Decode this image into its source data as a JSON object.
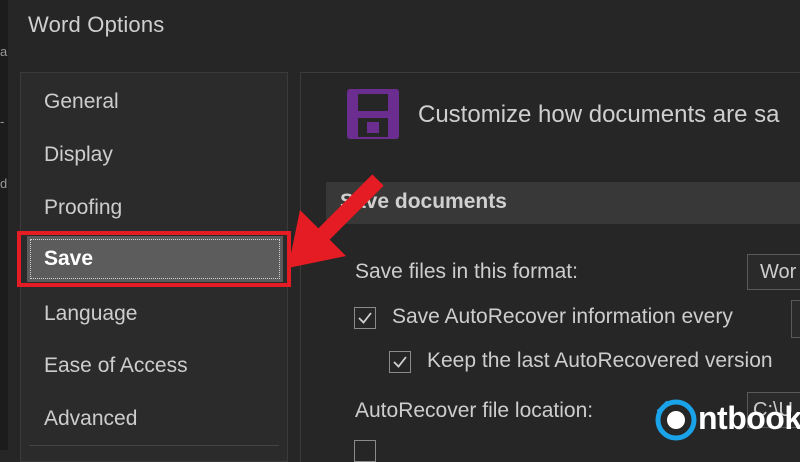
{
  "window": {
    "title": "Word Options"
  },
  "nav": {
    "items": [
      {
        "label": "General"
      },
      {
        "label": "Display"
      },
      {
        "label": "Proofing"
      },
      {
        "label": "Save",
        "selected": true
      },
      {
        "label": "Language"
      },
      {
        "label": "Ease of Access"
      },
      {
        "label": "Advanced"
      }
    ]
  },
  "content": {
    "heading": "Customize how documents are sa",
    "section_title": "Save documents",
    "format_label": "Save files in this format:",
    "format_value": "Wor",
    "autorecover_label": "Save AutoRecover information every",
    "autorecover_checked": true,
    "keep_last_label": "Keep the last AutoRecovered version",
    "keep_last_checked": true,
    "location_label": "AutoRecover file location:",
    "location_value": "C:\\U"
  },
  "colors": {
    "accent_red": "#e51c23",
    "floppy_purple": "#6b2d8f",
    "brand_blue": "#1aa3e8"
  },
  "icons": {
    "floppy": "floppy-disk-icon",
    "arrow": "red-pointer-arrow",
    "check": "checkmark-icon"
  },
  "watermark": {
    "text": "ntbook"
  }
}
